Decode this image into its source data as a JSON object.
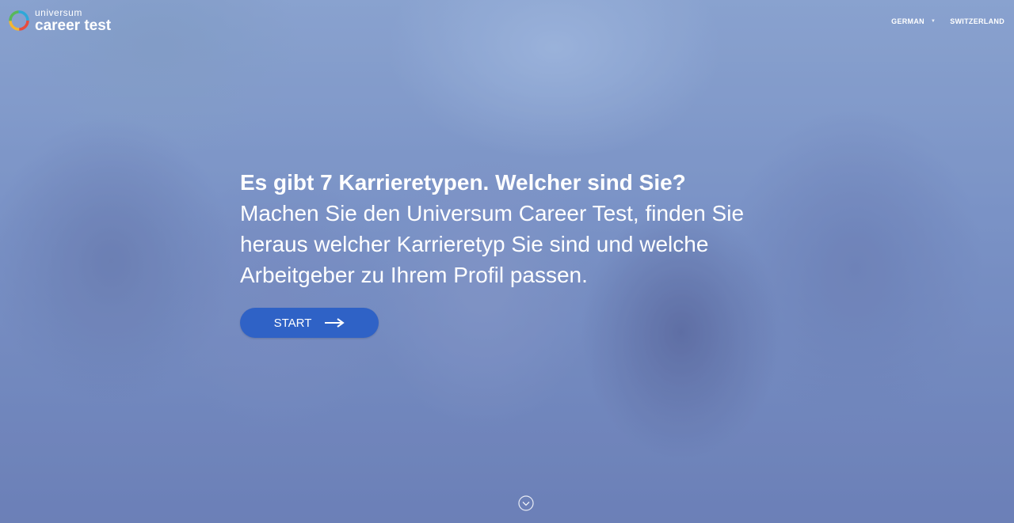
{
  "brand": {
    "top": "universum",
    "main": "career test"
  },
  "nav": {
    "language": "GERMAN",
    "country": "SWITZERLAND"
  },
  "hero": {
    "headline": "Es gibt 7 Karrieretypen. Welcher sind Sie?",
    "subline": "Machen Sie den Universum Career Test, finden Sie heraus welcher Karrieretyp Sie sind und welche Arbeitgeber zu Ihrem Profil passen.",
    "cta_label": "START"
  },
  "icons": {
    "logo": "ring-logo-icon",
    "cta": "arrow-right-icon",
    "scroll": "chevron-down-circle-icon",
    "dropdown": "caret-down-icon"
  },
  "colors": {
    "cta_background": "#2f62c6",
    "text": "#ffffff"
  }
}
